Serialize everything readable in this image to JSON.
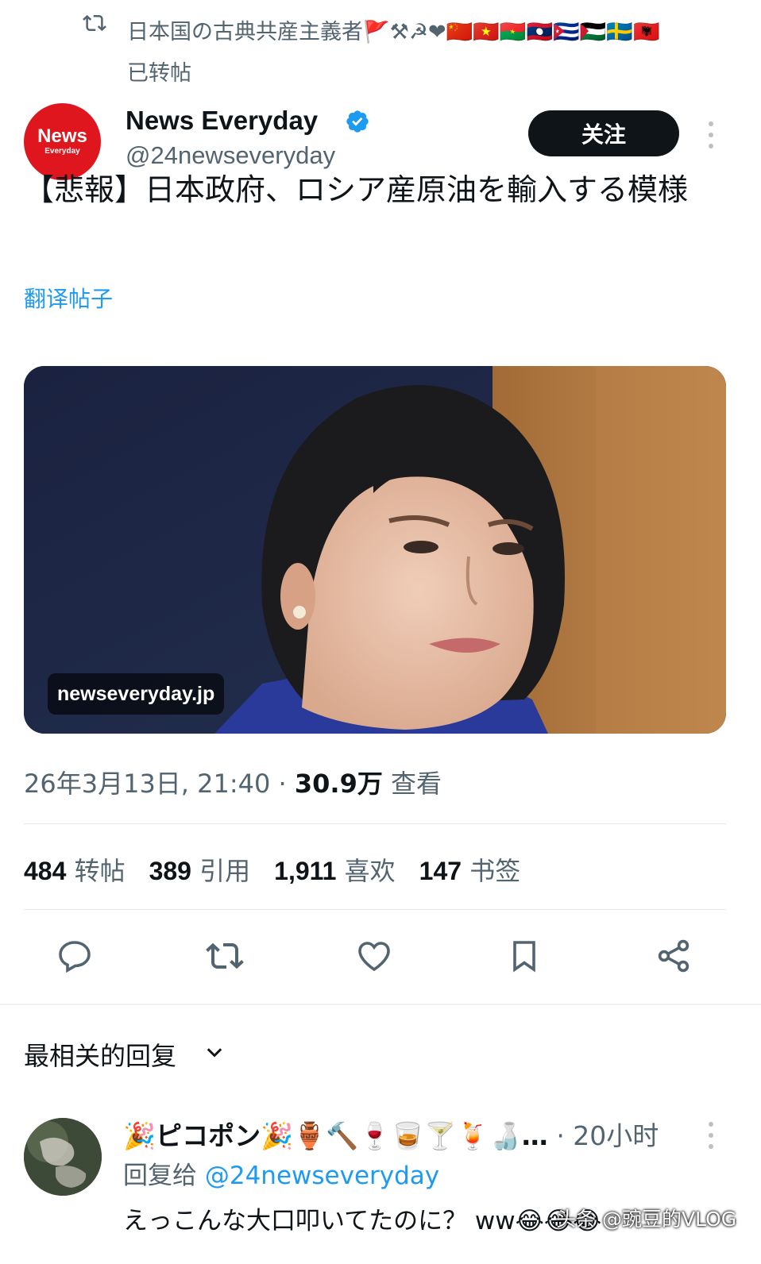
{
  "retweet": {
    "user": "日本国の古典共産主義者🚩⚒☭❤🇨🇳🇻🇳🇧🇫🇱🇦🇨🇺🇵🇸🇸🇪🇦🇱",
    "label": "已转帖"
  },
  "author": {
    "avatar_line1": "News",
    "avatar_line2": "Everyday",
    "name": "News Everyday",
    "handle": "@24newseveryday",
    "follow_label": "关注"
  },
  "tweet": {
    "text": "【悲報】日本政府、ロシア産原油を輸入する模様",
    "translate_label": "翻译帖子",
    "media_domain": "newseveryday.jp",
    "date": "26年3月13日, 21:40",
    "views_count": "30.9万",
    "views_label": "查看"
  },
  "stats": {
    "reposts": {
      "count": "484",
      "label": "转帖"
    },
    "quotes": {
      "count": "389",
      "label": "引用"
    },
    "likes": {
      "count": "1,911",
      "label": "喜欢"
    },
    "bookmarks": {
      "count": "147",
      "label": "书签"
    }
  },
  "actions": {
    "icons": [
      "reply-icon",
      "repost-icon",
      "like-icon",
      "bookmark-icon",
      "share-icon"
    ]
  },
  "replies": {
    "sort_label": "最相关的回复",
    "items": [
      {
        "name": "🎉ピコポン🎉🏺🔨🍷🥃🍸🍹🍶…",
        "time": "· 20小时",
        "reply_prefix": "回复给",
        "reply_handle": "@24newseveryday",
        "text": "えっこんな大口叩いてたのに？ ww😂😂😂"
      }
    ]
  },
  "watermark": "头条 @豌豆的VLOG",
  "colors": {
    "accent": "#1d9bf0",
    "muted": "#536471",
    "text": "#0f1419",
    "brand_red": "#e0161e"
  }
}
